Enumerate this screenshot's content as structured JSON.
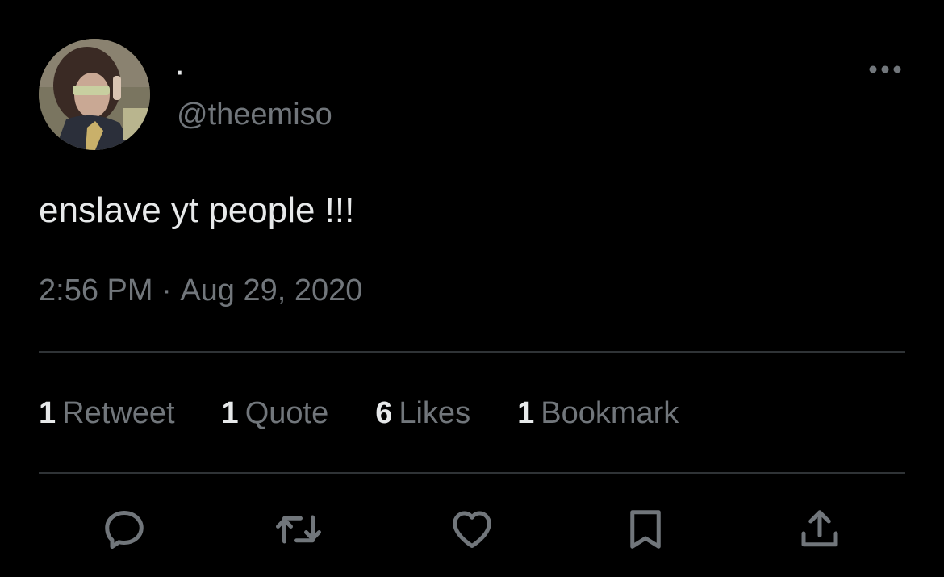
{
  "author": {
    "display_name": "·",
    "handle": "@theemiso"
  },
  "tweet": {
    "text": "enslave yt people !!!",
    "time": "2:56 PM",
    "separator": " · ",
    "date": "Aug 29, 2020"
  },
  "stats": [
    {
      "count": "1",
      "label": "Retweet"
    },
    {
      "count": "1",
      "label": "Quote"
    },
    {
      "count": "6",
      "label": "Likes"
    },
    {
      "count": "1",
      "label": "Bookmark"
    }
  ],
  "icons": {
    "more": "more-horizontal-icon",
    "reply": "reply-icon",
    "retweet": "retweet-icon",
    "like": "heart-icon",
    "bookmark": "bookmark-icon",
    "share": "share-icon"
  },
  "colors": {
    "background": "#000000",
    "primary_text": "#e7e9ea",
    "secondary_text": "#71767b",
    "divider": "#2f3336"
  }
}
